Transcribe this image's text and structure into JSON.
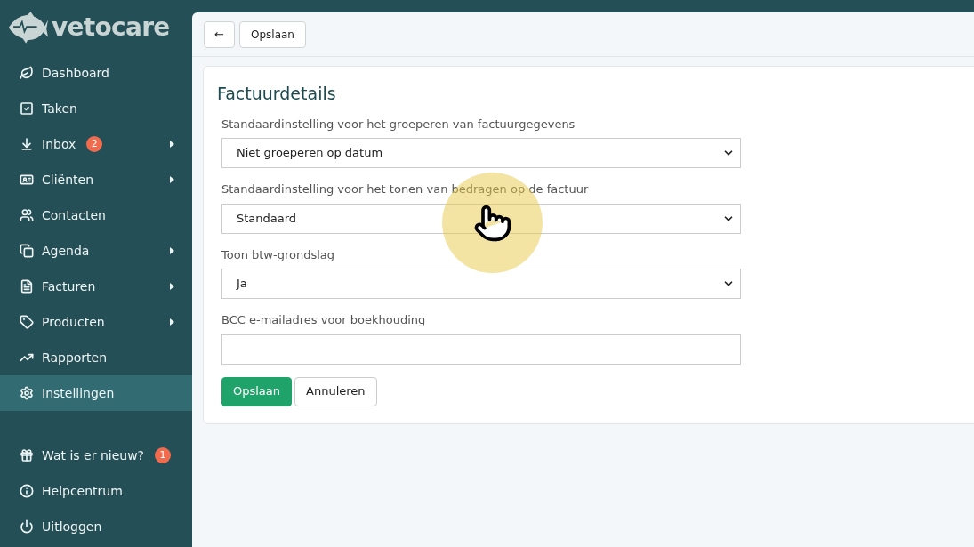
{
  "logo": {
    "text": "vetocare"
  },
  "sidebar": {
    "items": [
      {
        "kind": "leaf",
        "label": "Dashboard",
        "selected": false,
        "expandable": false
      },
      {
        "kind": "check",
        "label": "Taken",
        "selected": false,
        "expandable": false
      },
      {
        "kind": "inbox",
        "label": "Inbox",
        "badge": "2",
        "selected": false,
        "expandable": true
      },
      {
        "kind": "card",
        "label": "Cliënten",
        "selected": false,
        "expandable": true
      },
      {
        "kind": "people",
        "label": "Contacten",
        "selected": false,
        "expandable": false
      },
      {
        "kind": "calendar",
        "label": "Agenda",
        "selected": false,
        "expandable": true
      },
      {
        "kind": "invoice",
        "label": "Facturen",
        "selected": false,
        "expandable": true
      },
      {
        "kind": "tag",
        "label": "Producten",
        "selected": false,
        "expandable": true
      },
      {
        "kind": "chart",
        "label": "Rapporten",
        "selected": false,
        "expandable": false
      },
      {
        "kind": "gear",
        "label": "Instellingen",
        "selected": true,
        "expandable": false
      }
    ],
    "bottom_items": [
      {
        "kind": "gift",
        "label": "Wat is er nieuw?",
        "badge": "1"
      },
      {
        "kind": "info",
        "label": "Helpcentrum"
      },
      {
        "kind": "power",
        "label": "Uitloggen"
      }
    ]
  },
  "toolbar": {
    "back": "←",
    "save": "Opslaan"
  },
  "form": {
    "title": "Factuurdetails",
    "fields": [
      {
        "kind": "select",
        "label": "Standaardinstelling voor het groeperen van factuurgegevens",
        "value": "Niet groeperen op datum"
      },
      {
        "kind": "select",
        "label": "Standaardinstelling voor het tonen van bedragen op de factuur",
        "value": "Standaard"
      },
      {
        "kind": "select",
        "label": "Toon btw-grondslag",
        "value": "Ja"
      },
      {
        "kind": "input",
        "label": "BCC e-mailadres voor boekhouding"
      }
    ],
    "buttons": [
      {
        "kind": "primary",
        "label": "Opslaan"
      },
      {
        "kind": "secondary",
        "label": "Annuleren"
      }
    ]
  }
}
